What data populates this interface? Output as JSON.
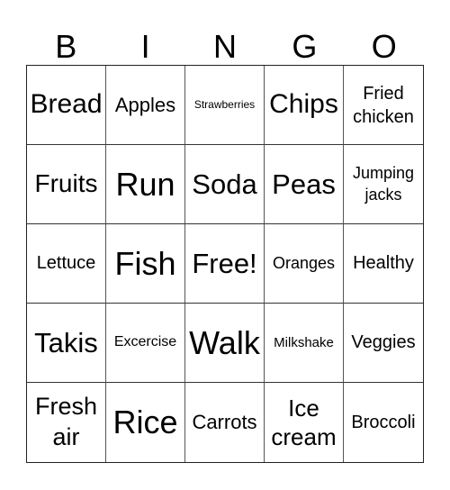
{
  "card": {
    "header": [
      "B",
      "I",
      "N",
      "G",
      "O"
    ],
    "rows": [
      [
        "Bread",
        "Apples",
        "Strawberries",
        "Chips",
        "Fried chicken"
      ],
      [
        "Fruits",
        "Run",
        "Soda",
        "Peas",
        "Jumping jacks"
      ],
      [
        "Lettuce",
        "Fish",
        "Free!",
        "Oranges",
        "Healthy"
      ],
      [
        "Takis",
        "Excercise",
        "Walk",
        "Milkshake",
        "Veggies"
      ],
      [
        "Fresh air",
        "Rice",
        "Carrots",
        "Ice cream",
        "Broccoli"
      ]
    ],
    "free_space": "Free!"
  }
}
